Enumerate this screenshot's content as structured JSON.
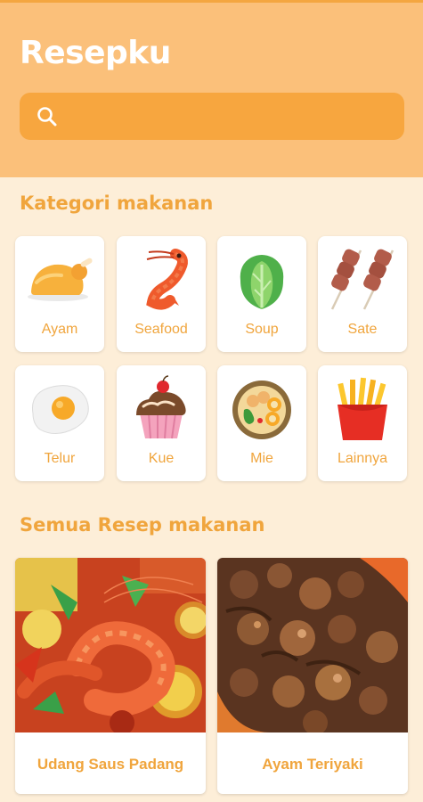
{
  "app": {
    "title": "Resepku"
  },
  "search": {
    "placeholder": ""
  },
  "colors": {
    "header_bg": "#fbc07a",
    "search_bg": "#f7a63f",
    "accent": "#f0a53d",
    "page_bg": "#fdeed8"
  },
  "categories": {
    "title": "Kategori makanan",
    "items": [
      {
        "label": "Ayam",
        "icon": "roast-chicken-icon"
      },
      {
        "label": "Seafood",
        "icon": "shrimp-icon"
      },
      {
        "label": "Soup",
        "icon": "lettuce-icon"
      },
      {
        "label": "Sate",
        "icon": "skewer-icon"
      },
      {
        "label": "Telur",
        "icon": "fried-egg-icon"
      },
      {
        "label": "Kue",
        "icon": "cupcake-icon"
      },
      {
        "label": "Mie",
        "icon": "noodle-bowl-icon"
      },
      {
        "label": "Lainnya",
        "icon": "french-fries-icon"
      }
    ]
  },
  "recipes": {
    "title": "Semua Resep makanan",
    "items": [
      {
        "name": "Udang Saus Padang",
        "image": "shrimp-dish-photo"
      },
      {
        "name": "Ayam Teriyaki",
        "image": "chicken-teriyaki-photo"
      }
    ]
  }
}
